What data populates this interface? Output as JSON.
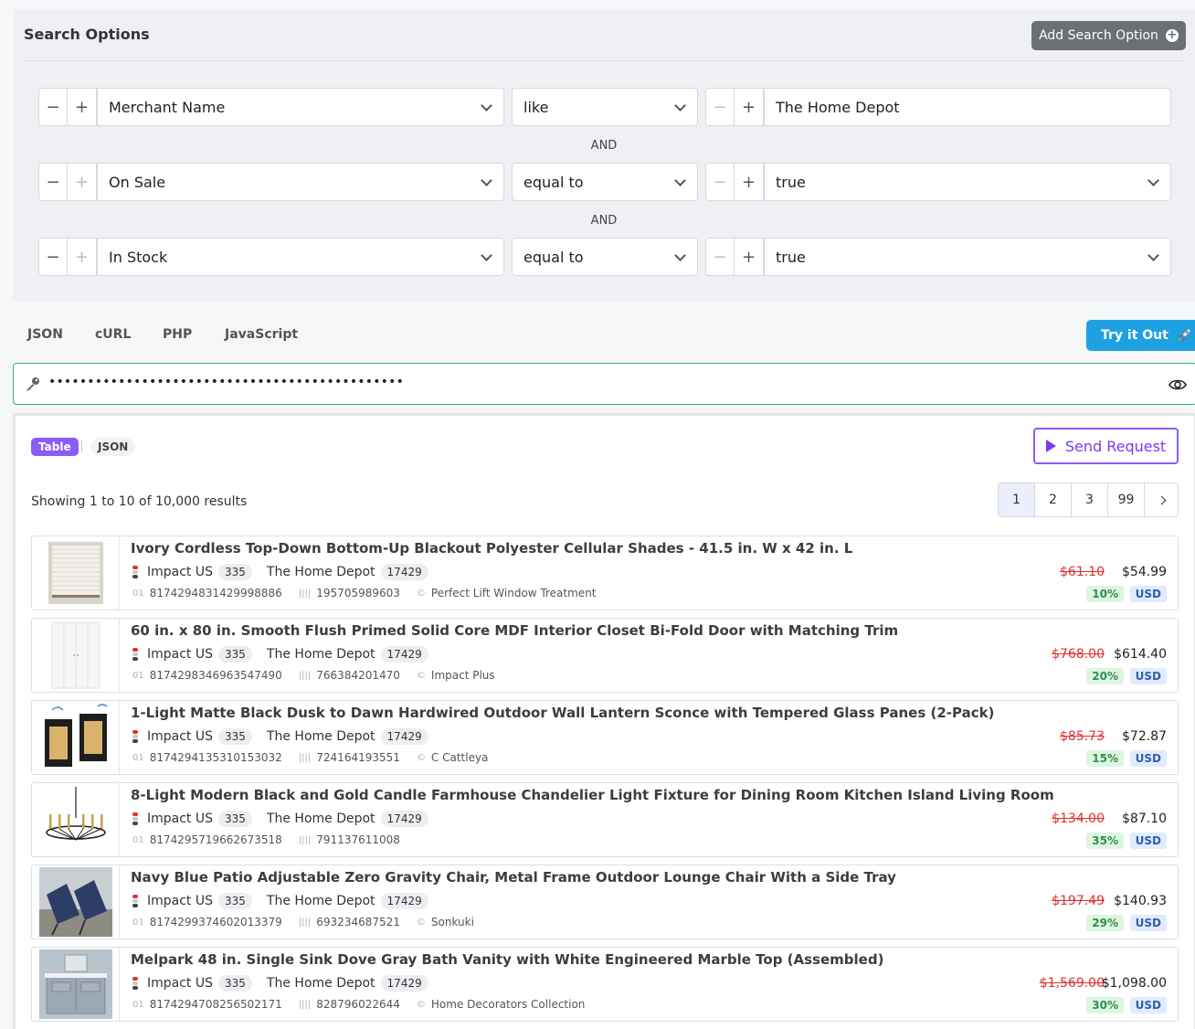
{
  "search": {
    "title": "Search Options",
    "add_option_label": "Add Search Option",
    "and_label": "AND",
    "rows": [
      {
        "field": "Merchant Name",
        "operator": "like",
        "value": "The Home Depot"
      },
      {
        "field": "On Sale",
        "operator": "equal to",
        "value": "true"
      },
      {
        "field": "In Stock",
        "operator": "equal to",
        "value": "true"
      }
    ]
  },
  "code_tabs": [
    "JSON",
    "cURL",
    "PHP",
    "JavaScript"
  ],
  "try_label": "Try it Out",
  "try_icon": "rocket-icon",
  "api_key": {
    "masked": "••••••••••••••••••••••••••••••••••••••••••••••",
    "icon": "key-icon",
    "toggle_icon": "eye-icon"
  },
  "results": {
    "view_table": "Table",
    "view_json": "JSON",
    "send_label": "Send Request",
    "showing": "Showing 1 to 10 of 10,000 results",
    "pages": [
      "1",
      "2",
      "3",
      "99"
    ],
    "active_page": "1",
    "colors": {
      "accent": "#8b5cf6",
      "try": "#1da1e2",
      "sale": "#e03131"
    },
    "items": [
      {
        "title": "Ivory Cordless Top-Down Bottom-Up Blackout Polyester Cellular Shades - 41.5 in. W x 42 in. L",
        "network": "Impact US",
        "network_count": "335",
        "merchant": "The Home Depot",
        "merchant_count": "17429",
        "id": "8174294831429998886",
        "upc": "195705989603",
        "brand": "Perfect Lift Window Treatment",
        "old_price": "$61.10",
        "price": "$54.99",
        "discount": "10%",
        "currency": "USD",
        "thumb": "shade"
      },
      {
        "title": "60 in. x 80 in. Smooth Flush Primed Solid Core MDF Interior Closet Bi-Fold Door with Matching Trim",
        "network": "Impact US",
        "network_count": "335",
        "merchant": "The Home Depot",
        "merchant_count": "17429",
        "id": "8174298346963547490",
        "upc": "766384201470",
        "brand": "Impact Plus",
        "old_price": "$768.00",
        "price": "$614.40",
        "discount": "20%",
        "currency": "USD",
        "thumb": "door"
      },
      {
        "title": "1-Light Matte Black Dusk to Dawn Hardwired Outdoor Wall Lantern Sconce with Tempered Glass Panes (2-Pack)",
        "network": "Impact US",
        "network_count": "335",
        "merchant": "The Home Depot",
        "merchant_count": "17429",
        "id": "8174294135310153032",
        "upc": "724164193551",
        "brand": "C Cattleya",
        "old_price": "$85.73",
        "price": "$72.87",
        "discount": "15%",
        "currency": "USD",
        "thumb": "lantern"
      },
      {
        "title": "8-Light Modern Black and Gold Candle Farmhouse Chandelier Light Fixture for Dining Room Kitchen Island Living Room",
        "network": "Impact US",
        "network_count": "335",
        "merchant": "The Home Depot",
        "merchant_count": "17429",
        "id": "8174295719662673518",
        "upc": "791137611008",
        "brand": "",
        "old_price": "$134.00",
        "price": "$87.10",
        "discount": "35%",
        "currency": "USD",
        "thumb": "chandelier"
      },
      {
        "title": "Navy Blue Patio Adjustable Zero Gravity Chair, Metal Frame Outdoor Lounge Chair With a Side Tray",
        "network": "Impact US",
        "network_count": "335",
        "merchant": "The Home Depot",
        "merchant_count": "17429",
        "id": "8174299374602013379",
        "upc": "693234687521",
        "brand": "Sonkuki",
        "old_price": "$197.49",
        "price": "$140.93",
        "discount": "29%",
        "currency": "USD",
        "thumb": "chair"
      },
      {
        "title": "Melpark 48 in. Single Sink Dove Gray Bath Vanity with White Engineered Marble Top (Assembled)",
        "network": "Impact US",
        "network_count": "335",
        "merchant": "The Home Depot",
        "merchant_count": "17429",
        "id": "8174294708256502171",
        "upc": "828796022644",
        "brand": "Home Decorators Collection",
        "old_price": "$1,569.00",
        "price": "$1,098.00",
        "discount": "30%",
        "currency": "USD",
        "thumb": "vanity"
      }
    ]
  }
}
